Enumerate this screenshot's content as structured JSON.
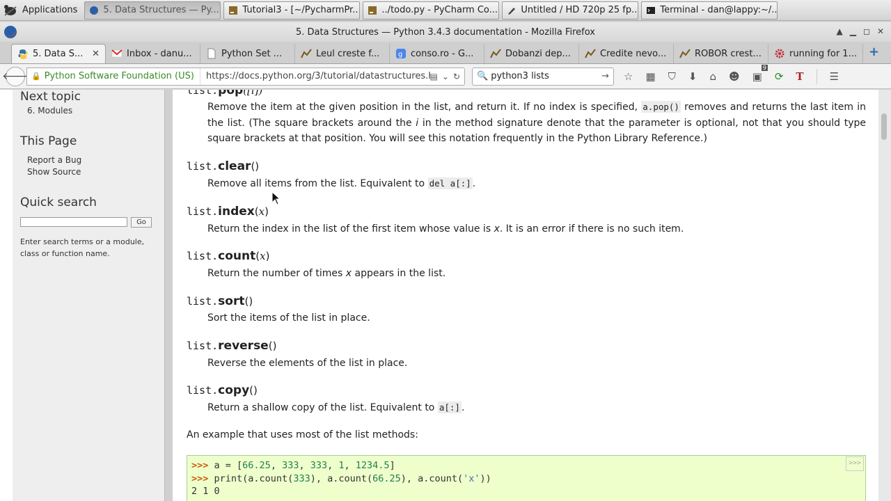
{
  "panel": {
    "apps_label": "Applications",
    "tasks": [
      {
        "label": "5. Data Structures — Py...",
        "icon": "firefox-icon"
      },
      {
        "label": "Tutorial3 - [~/PycharmPr...",
        "icon": "pycharm-icon"
      },
      {
        "label": "../todo.py - PyCharm Co...",
        "icon": "pycharm-icon"
      },
      {
        "label": "Untitled / HD 720p 25 fp...",
        "icon": "editor-icon"
      },
      {
        "label": "Terminal - dan@lappy:~/...",
        "icon": "terminal-icon"
      }
    ]
  },
  "window": {
    "title": "5. Data Structures — Python 3.4.3 documentation - Mozilla Firefox"
  },
  "tabs": [
    {
      "label": "5. Data S...",
      "icon": "python-icon"
    },
    {
      "label": "Inbox - danu...",
      "icon": "gmail-icon"
    },
    {
      "label": "Python Set ...",
      "icon": "page-icon"
    },
    {
      "label": "Leul creste f...",
      "icon": "chart-icon"
    },
    {
      "label": "conso.ro - G...",
      "icon": "google-icon"
    },
    {
      "label": "Dobanzi dep...",
      "icon": "chart-icon"
    },
    {
      "label": "Credite nevo...",
      "icon": "chart-icon"
    },
    {
      "label": "ROBOR crest...",
      "icon": "chart-icon"
    },
    {
      "label": "running for 1...",
      "icon": "gear-icon"
    }
  ],
  "nav": {
    "identity": "Python Software Foundation (US)",
    "url": "https://docs.python.org/3/tutorial/datastructures.ht",
    "search_value": "python3 lists",
    "badge": "9"
  },
  "sidebar": {
    "next_topic": "Next topic",
    "next_link": "6. Modules",
    "this_page": "This Page",
    "report_bug": "Report a Bug",
    "show_source": "Show Source",
    "quick_search": "Quick search",
    "go_label": "Go",
    "help": "Enter search terms or a module, class or function name."
  },
  "doc": {
    "pop_sig_prefix": "list.",
    "pop_name": "pop",
    "pop_args": "([i])",
    "pop_desc_1": "Remove the item at the given position in the list, and return it. If no index is specified,",
    "pop_code": "a.pop()",
    "pop_desc_2": "removes and returns the last item in the list. (The square brackets around the",
    "pop_i": "i",
    "pop_desc_3": "in the method signature denote that the parameter is optional, not that you should type square brackets at that position. You will see this notation frequently in the Python Library Reference.)",
    "methods": [
      {
        "prefix": "list.",
        "name": "clear",
        "args": "()",
        "desc": "Remove all items from the list. Equivalent to",
        "code": "del a[:]",
        "tail": "."
      },
      {
        "prefix": "list.",
        "name": "index",
        "args_open": "(",
        "arg": "x",
        "args_close": ")",
        "desc": "Return the index in the list of the first item whose value is",
        "var": "x",
        "tail": ". It is an error if there is no such item."
      },
      {
        "prefix": "list.",
        "name": "count",
        "args_open": "(",
        "arg": "x",
        "args_close": ")",
        "desc": "Return the number of times",
        "var": "x",
        "tail": "appears in the list."
      },
      {
        "prefix": "list.",
        "name": "sort",
        "args": "()",
        "desc": "Sort the items of the list in place."
      },
      {
        "prefix": "list.",
        "name": "reverse",
        "args": "()",
        "desc": "Reverse the elements of the list in place."
      },
      {
        "prefix": "list.",
        "name": "copy",
        "args": "()",
        "desc": "Return a shallow copy of the list. Equivalent to",
        "code": "a[:]",
        "tail": "."
      }
    ],
    "example_intro": "An example that uses most of the list methods:",
    "code_lines": {
      "l1_prompt": ">>>",
      "l1_a": " a = [",
      "l1_n1": "66.25",
      "l1_c1": ", ",
      "l1_n2": "333",
      "l1_c2": ", ",
      "l1_n3": "333",
      "l1_c3": ", ",
      "l1_n4": "1",
      "l1_c4": ", ",
      "l1_n5": "1234.5",
      "l1_end": "]",
      "l2_prompt": ">>>",
      "l2_a": " print(a.count(",
      "l2_n1": "333",
      "l2_b": "), a.count(",
      "l2_n2": "66.25",
      "l2_c": "), a.count(",
      "l2_s": "'x'",
      "l2_end": "))",
      "l3": "2 1 0",
      "copy_btn": ">>>"
    }
  }
}
